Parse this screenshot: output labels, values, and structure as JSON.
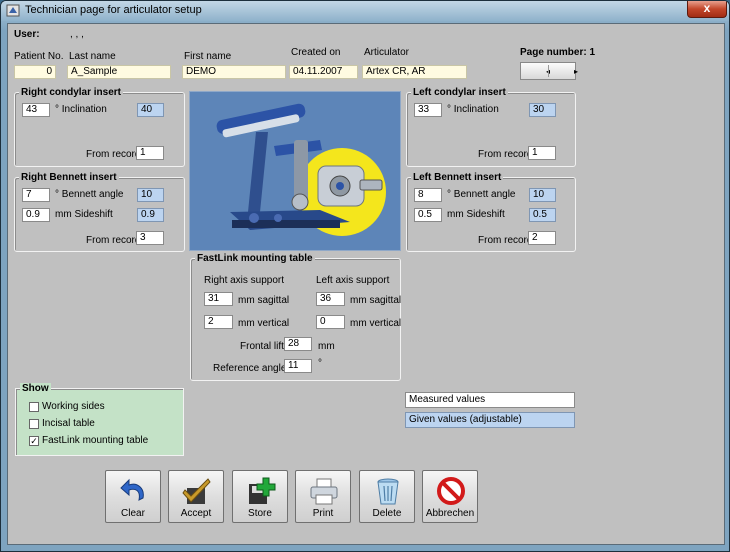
{
  "window": {
    "title": "Technician page for articulator setup",
    "close_glyph": "x"
  },
  "header": {
    "user_label": "User:",
    "user_value": ", , ,",
    "patient_no_label": "Patient No.",
    "patient_no": "0",
    "last_name_label": "Last name",
    "last_name": "A_Sample",
    "first_name_label": "First name",
    "first_name": "DEMO",
    "created_on_label": "Created on",
    "created_on": "04.11.2007",
    "articulator_label": "Articulator",
    "articulator": "Artex CR, AR",
    "page_number_label": "Page number: 1",
    "pager_prev": "◂",
    "pager_next": "▸"
  },
  "right_condylar": {
    "title": "Right condylar insert",
    "inclination_measured": "43",
    "inclination_label": "° Inclination",
    "inclination_given": "40",
    "from_record_label": "From record",
    "from_record": "1"
  },
  "left_condylar": {
    "title": "Left condylar insert",
    "inclination_measured": "33",
    "inclination_label": "° Inclination",
    "inclination_given": "30",
    "from_record_label": "From record",
    "from_record": "1"
  },
  "right_bennett": {
    "title": "Right Bennett insert",
    "angle_measured": "7",
    "angle_label": "° Bennett angle",
    "angle_given": "10",
    "sideshift_measured": "0.9",
    "sideshift_label": "mm Sideshift",
    "sideshift_given": "0.9",
    "from_record_label": "From record",
    "from_record": "3"
  },
  "left_bennett": {
    "title": "Left Bennett insert",
    "angle_measured": "8",
    "angle_label": "° Bennett angle",
    "angle_given": "10",
    "sideshift_measured": "0.5",
    "sideshift_label": "mm Sideshift",
    "sideshift_given": "0.5",
    "from_record_label": "From record",
    "from_record": "2"
  },
  "fastlink": {
    "title": "FastLink mounting table",
    "right_axis_label": "Right axis support",
    "left_axis_label": "Left axis support",
    "right_sagittal": "31",
    "left_sagittal": "36",
    "sagittal_label": "mm sagittal",
    "right_vertical": "2",
    "left_vertical": "0",
    "vertical_label": "mm vertical",
    "frontal_lift_label": "Frontal lift",
    "frontal_lift": "28",
    "frontal_lift_unit": "mm",
    "reference_angle_label": "Reference angle",
    "reference_angle": "11",
    "reference_angle_unit": "°"
  },
  "show": {
    "title": "Show",
    "items": [
      {
        "label": "Working sides",
        "checked": false
      },
      {
        "label": "Incisal table",
        "checked": false
      },
      {
        "label": "FastLink mounting table",
        "checked": true
      }
    ],
    "check_glyph": "✓"
  },
  "legend": {
    "measured": "Measured values",
    "given": "Given values (adjustable)"
  },
  "buttons": {
    "clear": "Clear",
    "accept": "Accept",
    "store": "Store",
    "print": "Print",
    "delete": "Delete",
    "cancel": "Abbrechen"
  },
  "colors": {
    "input_yellow": "#fffbe1",
    "given_blue": "#bcd4f0",
    "show_green": "#c4e2c7",
    "panel_gray": "#c0c0c0",
    "photo_blue": "#5d85b8"
  }
}
